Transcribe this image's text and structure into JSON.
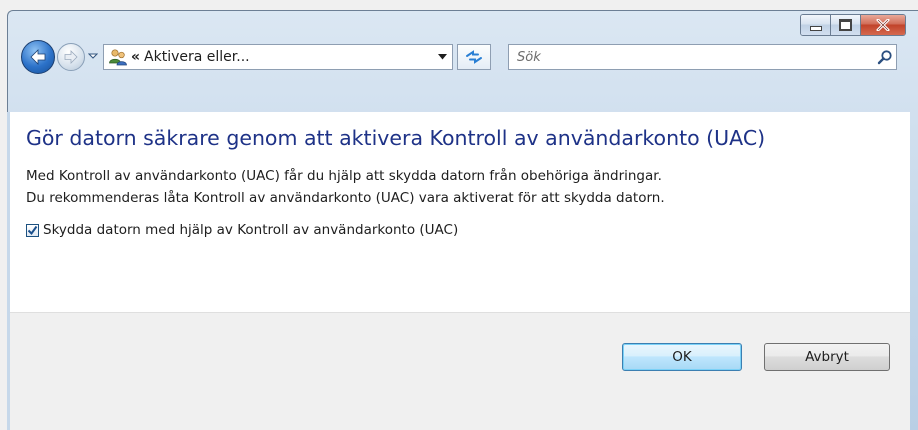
{
  "window": {
    "caption_buttons": [
      "minimize",
      "maximize",
      "close"
    ]
  },
  "nav": {
    "address_chevron": "«",
    "address_text": "Aktivera eller...",
    "search_placeholder": "Sök"
  },
  "content": {
    "title": "Gör datorn säkrare genom att aktivera Kontroll av användarkonto (UAC)",
    "description_line1": "Med Kontroll av användarkonto (UAC) får du hjälp att skydda datorn från obehöriga ändringar.",
    "description_line2": "Du rekommenderas låta Kontroll av användarkonto (UAC) vara aktiverat för att skydda datorn.",
    "checkbox_label": "Skydda datorn med hjälp av Kontroll av användarkonto (UAC)",
    "checkbox_checked": true
  },
  "footer": {
    "ok_label": "OK",
    "cancel_label": "Avbryt"
  },
  "icons": {
    "back": "back-arrow-icon",
    "forward": "forward-arrow-icon",
    "address": "users-icon",
    "refresh": "refresh-icon",
    "search": "search-icon"
  },
  "colors": {
    "title": "#1e3287",
    "accent_button": "#3c7fb1"
  }
}
